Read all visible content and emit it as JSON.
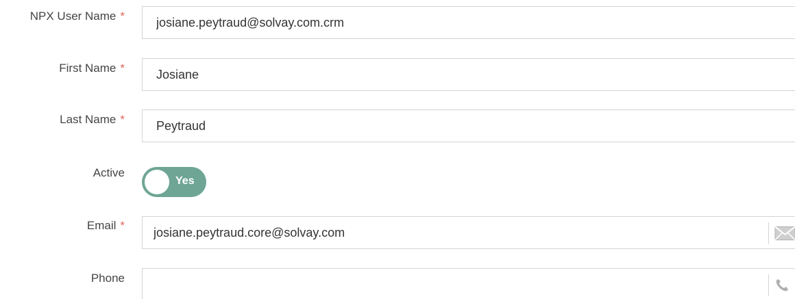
{
  "form": {
    "npx_user_name": {
      "label": "NPX User Name",
      "required_marker": "*",
      "value": "josiane.peytraud@solvay.com.crm"
    },
    "first_name": {
      "label": "First Name",
      "required_marker": "*",
      "value": "Josiane"
    },
    "last_name": {
      "label": "Last Name",
      "required_marker": "*",
      "value": "Peytraud"
    },
    "active": {
      "label": "Active",
      "toggle_text": "Yes",
      "state": "on",
      "color": "#6fa595"
    },
    "email": {
      "label": "Email",
      "required_marker": "*",
      "value": "josiane.peytraud.core@solvay.com",
      "icon": "envelope-icon"
    },
    "phone": {
      "label": "Phone",
      "value": "",
      "icon": "phone-icon"
    }
  },
  "colors": {
    "required": "#e0655a",
    "border": "#d4d4d4",
    "icon": "#b0b0b0"
  }
}
